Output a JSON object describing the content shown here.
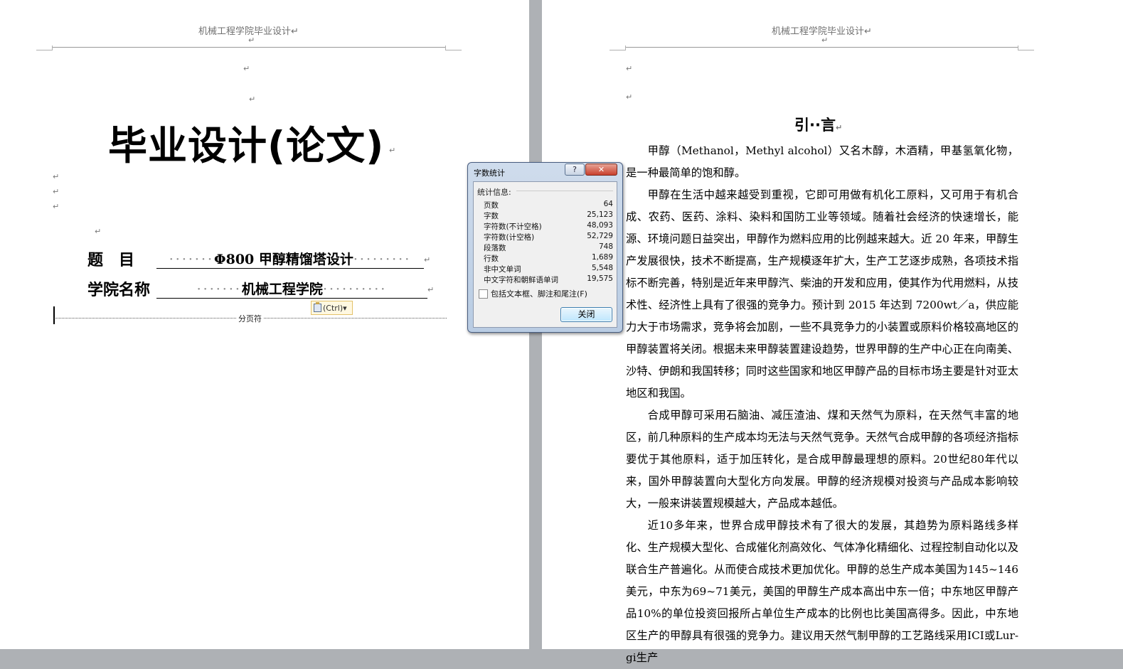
{
  "header_text": "机械工程学院毕业设计",
  "para_mark": "↵",
  "cover": {
    "title": "毕业设计(论文)",
    "fields": [
      {
        "label": "题　目",
        "value": "Φ800 甲醇精馏塔设计"
      },
      {
        "label": "学院名称",
        "value": "机械工程学院"
      }
    ],
    "page_break_label": "分页符",
    "paste_options_label": "(Ctrl)▾"
  },
  "intro": {
    "title": "引··言",
    "paragraphs": [
      "甲醇（Methanol，Methyl alcohol）又名木醇，木酒精，甲基氢氧化物，是一种最简单的饱和醇。",
      "甲醇在生活中越来越受到重视，它即可用做有机化工原料，又可用于有机合成、农药、医药、涂料、染料和国防工业等领域。随着社会经济的快速增长，能源、环境问题日益突出，甲醇作为燃料应用的比例越来越大。近 20 年来，甲醇生产发展很快，技术不断提高，生产规模逐年扩大，生产工艺逐步成熟，各项技术指标不断完善，特别是近年来甲醇汽、柴油的开发和应用，使其作为代用燃料，从技术性、经济性上具有了很强的竞争力。预计到 2015 年达到 7200wt／a，供应能力大于市场需求，竞争将会加剧，一些不具竞争力的小装置或原料价格较高地区的甲醇装置将关闭。根据未来甲醇装置建设趋势，世界甲醇的生产中心正在向南美、沙特、伊朗和我国转移；同时这些国家和地区甲醇产品的目标市场主要是针对亚太地区和我国。",
      "合成甲醇可采用石脑油、减压渣油、煤和天然气为原料，在天然气丰富的地区，前几种原料的生产成本均无法与天然气竞争。天然气合成甲醇的各项经济指标要优于其他原料，适于加压转化，是合成甲醇最理想的原料。20世纪80年代以来，国外甲醇装置向大型化方向发展。甲醇的经济规模对投资与产品成本影响较大，一般来讲装置规模越大，产品成本越低。",
      "近10多年来，世界合成甲醇技术有了很大的发展，其趋势为原料路线多样化、生产规模大型化、合成催化剂高效化、气体净化精细化、过程控制自动化以及联合生产普遍化。从而使合成技术更加优化。甲醇的总生产成本美国为145~146美元，中东为69~71美元，美国的甲醇生产成本高出中东一倍；中东地区甲醇产品10%的单位投资回报所占单位生产成本的比例也比美国高得多。因此，中东地区生产的甲醇具有很强的竞争力。建议用天然气制甲醇的工艺路线采用ICI或Lur-gi生产"
    ]
  },
  "dialog": {
    "title": "字数统计",
    "help_label": "?",
    "close_x": "✕",
    "group_label": "统计信息:",
    "stats": [
      {
        "label": "页数",
        "value": "64"
      },
      {
        "label": "字数",
        "value": "25,123"
      },
      {
        "label": "字符数(不计空格)",
        "value": "48,093"
      },
      {
        "label": "字符数(计空格)",
        "value": "52,729"
      },
      {
        "label": "段落数",
        "value": "748"
      },
      {
        "label": "行数",
        "value": "1,689"
      },
      {
        "label": "非中文单词",
        "value": "5,548"
      },
      {
        "label": "中文字符和朝鲜语单词",
        "value": "19,575"
      }
    ],
    "checkbox_label": "包括文本框、脚注和尾注(F)",
    "checkbox_checked": false,
    "close_button": "关闭"
  },
  "colors": {
    "workspace": "#aeb1b5",
    "page": "#ffffff",
    "header_text": "#707070"
  }
}
